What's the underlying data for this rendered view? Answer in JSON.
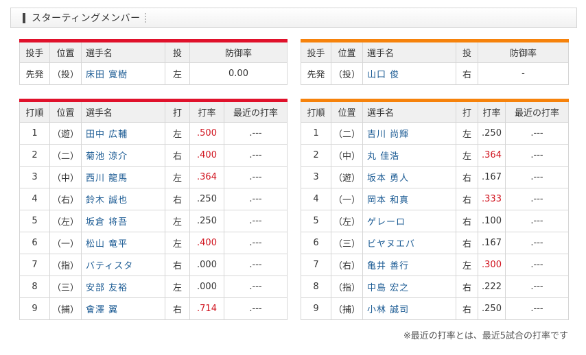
{
  "header": {
    "title": "スターティングメンバー"
  },
  "pitcher_headers": [
    "投手",
    "位置",
    "選手名",
    "投",
    "防御率"
  ],
  "lineup_headers": [
    "打順",
    "位置",
    "選手名",
    "打",
    "打率",
    "最近の打率"
  ],
  "teams": [
    {
      "accent": "#e0112b",
      "pitcher": {
        "role": "先発",
        "pos": "（投）",
        "name": "床田 寛樹",
        "hand": "左",
        "era": "0.00"
      },
      "lineup": [
        {
          "order": "1",
          "pos": "（遊）",
          "name": "田中 広輔",
          "hand": "左",
          "avg": ".500",
          "recent": ".---",
          "red": true
        },
        {
          "order": "2",
          "pos": "（二）",
          "name": "菊池 涼介",
          "hand": "右",
          "avg": ".400",
          "recent": ".---",
          "red": true
        },
        {
          "order": "3",
          "pos": "（中）",
          "name": "西川 龍馬",
          "hand": "左",
          "avg": ".364",
          "recent": ".---",
          "red": true
        },
        {
          "order": "4",
          "pos": "（右）",
          "name": "鈴木 誠也",
          "hand": "右",
          "avg": ".250",
          "recent": ".---",
          "red": false
        },
        {
          "order": "5",
          "pos": "（左）",
          "name": "坂倉 将吾",
          "hand": "左",
          "avg": ".250",
          "recent": ".---",
          "red": false
        },
        {
          "order": "6",
          "pos": "（一）",
          "name": "松山 竜平",
          "hand": "左",
          "avg": ".400",
          "recent": ".---",
          "red": true
        },
        {
          "order": "7",
          "pos": "（指）",
          "name": "バティスタ",
          "hand": "右",
          "avg": ".000",
          "recent": ".---",
          "red": false
        },
        {
          "order": "8",
          "pos": "（三）",
          "name": "安部 友裕",
          "hand": "左",
          "avg": ".000",
          "recent": ".---",
          "red": false
        },
        {
          "order": "9",
          "pos": "（捕）",
          "name": "會澤 翼",
          "hand": "右",
          "avg": ".714",
          "recent": ".---",
          "red": true
        }
      ]
    },
    {
      "accent": "#f6820b",
      "pitcher": {
        "role": "先発",
        "pos": "（投）",
        "name": "山口 俊",
        "hand": "右",
        "era": "-"
      },
      "lineup": [
        {
          "order": "1",
          "pos": "（二）",
          "name": "吉川 尚輝",
          "hand": "左",
          "avg": ".250",
          "recent": ".---",
          "red": false
        },
        {
          "order": "2",
          "pos": "（中）",
          "name": "丸 佳浩",
          "hand": "左",
          "avg": ".364",
          "recent": ".---",
          "red": true
        },
        {
          "order": "3",
          "pos": "（遊）",
          "name": "坂本 勇人",
          "hand": "右",
          "avg": ".167",
          "recent": ".---",
          "red": false
        },
        {
          "order": "4",
          "pos": "（一）",
          "name": "岡本 和真",
          "hand": "右",
          "avg": ".333",
          "recent": ".---",
          "red": true
        },
        {
          "order": "5",
          "pos": "（左）",
          "name": "ゲレーロ",
          "hand": "右",
          "avg": ".100",
          "recent": ".---",
          "red": false
        },
        {
          "order": "6",
          "pos": "（三）",
          "name": "ビヤヌエバ",
          "hand": "右",
          "avg": ".167",
          "recent": ".---",
          "red": false
        },
        {
          "order": "7",
          "pos": "（右）",
          "name": "亀井 善行",
          "hand": "左",
          "avg": ".300",
          "recent": ".---",
          "red": true
        },
        {
          "order": "8",
          "pos": "（指）",
          "name": "中島 宏之",
          "hand": "右",
          "avg": ".222",
          "recent": ".---",
          "red": false
        },
        {
          "order": "9",
          "pos": "（捕）",
          "name": "小林 誠司",
          "hand": "右",
          "avg": ".250",
          "recent": ".---",
          "red": false
        }
      ]
    }
  ],
  "note": "※最近の打率とは、最近5試合の打率です"
}
